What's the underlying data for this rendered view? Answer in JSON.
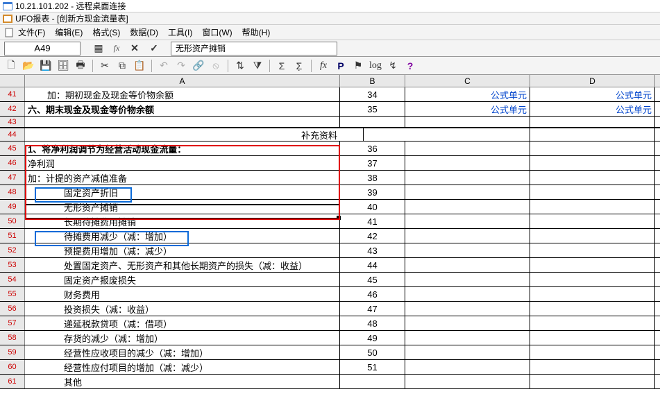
{
  "window": {
    "rdp_title": "10.21.101.202 - 远程桌面连接",
    "app_title": "UFO报表 - [创新方现金流量表]"
  },
  "menu": {
    "file": "文件(F)",
    "edit": "编辑(E)",
    "format": "格式(S)",
    "data": "数据(D)",
    "tools": "工具(I)",
    "window": "窗口(W)",
    "help": "帮助(H)"
  },
  "cellref": {
    "ref": "A49",
    "formula": "无形资产摊销"
  },
  "toolbar_icons": [
    "new",
    "open",
    "save",
    "saveall",
    "print",
    "|",
    "cut",
    "copy",
    "paste",
    "|",
    "undo",
    "redo",
    "link",
    "break",
    "|",
    "sort",
    "filter",
    "|",
    "sum",
    "sumlist",
    "|",
    "func",
    "P",
    "flag",
    "log",
    "arrow",
    "help"
  ],
  "colhdrs": {
    "A": "A",
    "B": "B",
    "C": "C",
    "D": "D"
  },
  "rows": [
    {
      "n": 41,
      "A": "加：期初现金及现金等价物余额",
      "B": "34",
      "C": "公式单元",
      "D": "公式单元",
      "cls": "indent1"
    },
    {
      "n": 42,
      "A": "六、期末现金及现金等价物余额",
      "B": "35",
      "C": "公式单元",
      "D": "公式单元",
      "cls": "bold"
    },
    {
      "n": 43,
      "A": "",
      "B": "",
      "C": "",
      "D": "",
      "thin": true
    },
    {
      "n": 44,
      "A": "",
      "B": "补充资料",
      "C": "",
      "D": "",
      "supp": true
    },
    {
      "n": 45,
      "A": "1、将净利润调节为经营活动现金流量：",
      "B": "36",
      "C": "",
      "D": "",
      "cls": "bold"
    },
    {
      "n": 46,
      "A": "净利润",
      "B": "37",
      "C": "",
      "D": ""
    },
    {
      "n": 47,
      "A": "加：计提的资产减值准备",
      "B": "38",
      "C": "",
      "D": ""
    },
    {
      "n": 48,
      "A": "固定资产折旧",
      "B": "39",
      "C": "",
      "D": "",
      "cls": "indent2"
    },
    {
      "n": 49,
      "A": "无形资产摊销",
      "B": "40",
      "C": "",
      "D": "",
      "cls": "indent2"
    },
    {
      "n": 50,
      "A": "长期待摊费用摊销",
      "B": "41",
      "C": "",
      "D": "",
      "cls": "indent2"
    },
    {
      "n": 51,
      "A": "待摊费用减少（减：增加）",
      "B": "42",
      "C": "",
      "D": "",
      "cls": "indent2"
    },
    {
      "n": 52,
      "A": "预提费用增加（减：减少）",
      "B": "43",
      "C": "",
      "D": "",
      "cls": "indent2"
    },
    {
      "n": 53,
      "A": "处置固定资产、无形资产和其他长期资产的损失（减：收益）",
      "B": "44",
      "C": "",
      "D": "",
      "cls": "indent2"
    },
    {
      "n": 54,
      "A": "固定资产报废损失",
      "B": "45",
      "C": "",
      "D": "",
      "cls": "indent2"
    },
    {
      "n": 55,
      "A": "财务费用",
      "B": "46",
      "C": "",
      "D": "",
      "cls": "indent2"
    },
    {
      "n": 56,
      "A": "投资损失（减：收益）",
      "B": "47",
      "C": "",
      "D": "",
      "cls": "indent2"
    },
    {
      "n": 57,
      "A": "递延税款贷项（减：借项）",
      "B": "48",
      "C": "",
      "D": "",
      "cls": "indent2"
    },
    {
      "n": 58,
      "A": "存货的减少（减：增加）",
      "B": "49",
      "C": "",
      "D": "",
      "cls": "indent2"
    },
    {
      "n": 59,
      "A": "经营性应收项目的减少（减：增加）",
      "B": "50",
      "C": "",
      "D": "",
      "cls": "indent2"
    },
    {
      "n": 60,
      "A": "经营性应付项目的增加（减：减少）",
      "B": "51",
      "C": "",
      "D": "",
      "cls": "indent2"
    },
    {
      "n": 61,
      "A": "其他",
      "B": "",
      "C": "",
      "D": "",
      "cls": "indent2"
    }
  ]
}
